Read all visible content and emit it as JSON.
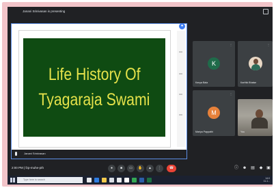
{
  "meeting": {
    "presenting_label": "Janani Srinivasan is presenting",
    "presenter_tile_name": "Janani Srinivasan",
    "time_code": "2:00 PM  |  fzp-muhe-pth"
  },
  "slide": {
    "line1": "Life History Of",
    "line2": "Tyagaraja Swami"
  },
  "participants": [
    {
      "name": "Kavya Bala",
      "initial": "K",
      "color": "#1f6b4a"
    },
    {
      "name": "Karthik Bhalse",
      "initial": "",
      "color": ""
    },
    {
      "name": "Mariya Pappathi",
      "initial": "M",
      "color": "#e7813a"
    },
    {
      "name": "You",
      "initial": "",
      "color": ""
    }
  ],
  "controls": {
    "buttons": [
      "mic-icon",
      "camera-icon",
      "captions-icon",
      "raise-hand-icon",
      "present-icon",
      "more-icon",
      "end-call-icon"
    ],
    "right": [
      "info-icon",
      "people-icon",
      "chat-icon",
      "activities-icon",
      "lock-icon"
    ]
  },
  "taskbar": {
    "search_placeholder": "Type here to search",
    "clock_time": "14:0",
    "clock_date": "11-1..."
  }
}
